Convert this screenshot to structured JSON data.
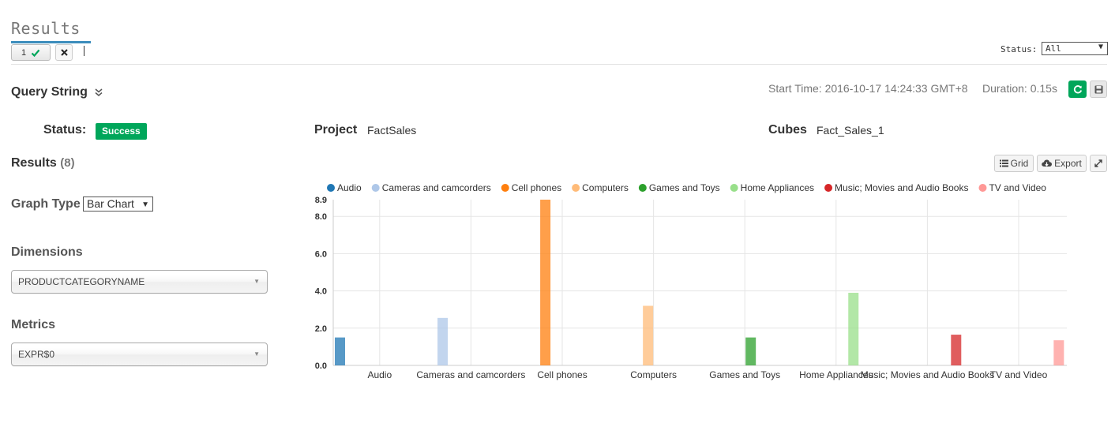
{
  "results_tab": {
    "title": "Results",
    "query_tab_label": "1",
    "status_filter_label": "Status:",
    "status_filter_value": "All"
  },
  "query": {
    "label": "Query String",
    "start_time": "Start Time: 2016-10-17 14:24:33 GMT+8",
    "duration": "Duration: 0.15s"
  },
  "info": {
    "status_label": "Status:",
    "status_value": "Success",
    "project_label": "Project",
    "project_value": "FactSales",
    "cubes_label": "Cubes",
    "cubes_value": "Fact_Sales_1"
  },
  "panel": {
    "results_label": "Results",
    "results_count": "(8)",
    "graph_type_label": "Graph Type",
    "graph_type_value": "Bar Chart",
    "dimensions_label": "Dimensions",
    "dimensions_value": "PRODUCTCATEGORYNAME",
    "metrics_label": "Metrics",
    "metrics_value": "EXPR$0"
  },
  "toolbar": {
    "grid_label": "Grid",
    "export_label": "Export"
  },
  "colors": {
    "success": "#00a65a",
    "tab_accent": "#3c8dbc"
  },
  "chart_data": {
    "type": "bar",
    "categories": [
      "Audio",
      "Cameras and camcorders",
      "Cell phones",
      "Computers",
      "Games and Toys",
      "Home Appliances",
      "Music; Movies and Audio Books",
      "TV and Video"
    ],
    "series": [
      {
        "name": "Audio",
        "color": "#1f77b4",
        "values": [
          1.5,
          null,
          null,
          null,
          null,
          null,
          null,
          null
        ]
      },
      {
        "name": "Cameras and camcorders",
        "color": "#aec7e8",
        "values": [
          null,
          2.55,
          null,
          null,
          null,
          null,
          null,
          null
        ]
      },
      {
        "name": "Cell phones",
        "color": "#ff7f0e",
        "values": [
          null,
          null,
          8.9,
          null,
          null,
          null,
          null,
          null
        ]
      },
      {
        "name": "Computers",
        "color": "#ffbb78",
        "values": [
          null,
          null,
          null,
          3.2,
          null,
          null,
          null,
          null
        ]
      },
      {
        "name": "Games and Toys",
        "color": "#2ca02c",
        "values": [
          null,
          null,
          null,
          null,
          1.5,
          null,
          null,
          null
        ]
      },
      {
        "name": "Home Appliances",
        "color": "#98df8a",
        "values": [
          null,
          null,
          null,
          null,
          null,
          3.9,
          null,
          null
        ]
      },
      {
        "name": "Music; Movies and Audio Books",
        "color": "#d62728",
        "values": [
          null,
          null,
          null,
          null,
          null,
          null,
          1.65,
          null
        ]
      },
      {
        "name": "TV and Video",
        "color": "#ff9896",
        "values": [
          null,
          null,
          null,
          null,
          null,
          null,
          null,
          1.35
        ]
      }
    ],
    "yticks": [
      "0.0",
      "2.0",
      "4.0",
      "6.0",
      "8.0",
      "8.9"
    ],
    "ylim": [
      0,
      8.9
    ],
    "grid": true,
    "legend_position": "top",
    "title": "",
    "xlabel": "",
    "ylabel": ""
  }
}
